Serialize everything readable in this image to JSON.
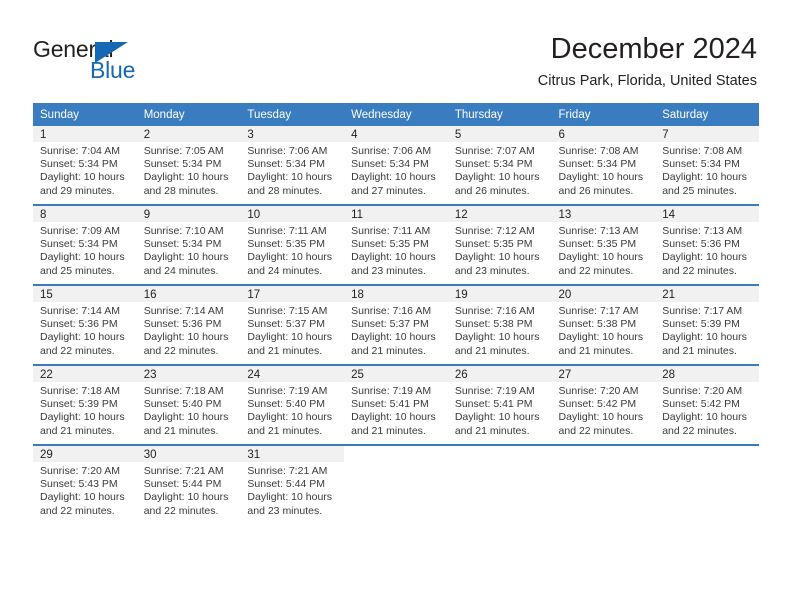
{
  "logo": {
    "text_primary": "General",
    "text_secondary": "Blue",
    "triangle_icon": "blue-triangle-icon",
    "primary_color": "#231f20",
    "secondary_color": "#1569b4"
  },
  "header": {
    "month_title": "December 2024",
    "location": "Citrus Park, Florida, United States"
  },
  "theme": {
    "header_bg": "#3a7cc0",
    "header_text": "#ffffff",
    "daynum_band_bg": "#f1f1f1",
    "cell_bg": "#ffffff",
    "body_text": "#3a3a3a",
    "separator": "#3a7cc0"
  },
  "weekdays": [
    "Sunday",
    "Monday",
    "Tuesday",
    "Wednesday",
    "Thursday",
    "Friday",
    "Saturday"
  ],
  "weeks": [
    [
      {
        "day": "1",
        "sunrise": "Sunrise: 7:04 AM",
        "sunset": "Sunset: 5:34 PM",
        "daylight": "Daylight: 10 hours and 29 minutes."
      },
      {
        "day": "2",
        "sunrise": "Sunrise: 7:05 AM",
        "sunset": "Sunset: 5:34 PM",
        "daylight": "Daylight: 10 hours and 28 minutes."
      },
      {
        "day": "3",
        "sunrise": "Sunrise: 7:06 AM",
        "sunset": "Sunset: 5:34 PM",
        "daylight": "Daylight: 10 hours and 28 minutes."
      },
      {
        "day": "4",
        "sunrise": "Sunrise: 7:06 AM",
        "sunset": "Sunset: 5:34 PM",
        "daylight": "Daylight: 10 hours and 27 minutes."
      },
      {
        "day": "5",
        "sunrise": "Sunrise: 7:07 AM",
        "sunset": "Sunset: 5:34 PM",
        "daylight": "Daylight: 10 hours and 26 minutes."
      },
      {
        "day": "6",
        "sunrise": "Sunrise: 7:08 AM",
        "sunset": "Sunset: 5:34 PM",
        "daylight": "Daylight: 10 hours and 26 minutes."
      },
      {
        "day": "7",
        "sunrise": "Sunrise: 7:08 AM",
        "sunset": "Sunset: 5:34 PM",
        "daylight": "Daylight: 10 hours and 25 minutes."
      }
    ],
    [
      {
        "day": "8",
        "sunrise": "Sunrise: 7:09 AM",
        "sunset": "Sunset: 5:34 PM",
        "daylight": "Daylight: 10 hours and 25 minutes."
      },
      {
        "day": "9",
        "sunrise": "Sunrise: 7:10 AM",
        "sunset": "Sunset: 5:34 PM",
        "daylight": "Daylight: 10 hours and 24 minutes."
      },
      {
        "day": "10",
        "sunrise": "Sunrise: 7:11 AM",
        "sunset": "Sunset: 5:35 PM",
        "daylight": "Daylight: 10 hours and 24 minutes."
      },
      {
        "day": "11",
        "sunrise": "Sunrise: 7:11 AM",
        "sunset": "Sunset: 5:35 PM",
        "daylight": "Daylight: 10 hours and 23 minutes."
      },
      {
        "day": "12",
        "sunrise": "Sunrise: 7:12 AM",
        "sunset": "Sunset: 5:35 PM",
        "daylight": "Daylight: 10 hours and 23 minutes."
      },
      {
        "day": "13",
        "sunrise": "Sunrise: 7:13 AM",
        "sunset": "Sunset: 5:35 PM",
        "daylight": "Daylight: 10 hours and 22 minutes."
      },
      {
        "day": "14",
        "sunrise": "Sunrise: 7:13 AM",
        "sunset": "Sunset: 5:36 PM",
        "daylight": "Daylight: 10 hours and 22 minutes."
      }
    ],
    [
      {
        "day": "15",
        "sunrise": "Sunrise: 7:14 AM",
        "sunset": "Sunset: 5:36 PM",
        "daylight": "Daylight: 10 hours and 22 minutes."
      },
      {
        "day": "16",
        "sunrise": "Sunrise: 7:14 AM",
        "sunset": "Sunset: 5:36 PM",
        "daylight": "Daylight: 10 hours and 22 minutes."
      },
      {
        "day": "17",
        "sunrise": "Sunrise: 7:15 AM",
        "sunset": "Sunset: 5:37 PM",
        "daylight": "Daylight: 10 hours and 21 minutes."
      },
      {
        "day": "18",
        "sunrise": "Sunrise: 7:16 AM",
        "sunset": "Sunset: 5:37 PM",
        "daylight": "Daylight: 10 hours and 21 minutes."
      },
      {
        "day": "19",
        "sunrise": "Sunrise: 7:16 AM",
        "sunset": "Sunset: 5:38 PM",
        "daylight": "Daylight: 10 hours and 21 minutes."
      },
      {
        "day": "20",
        "sunrise": "Sunrise: 7:17 AM",
        "sunset": "Sunset: 5:38 PM",
        "daylight": "Daylight: 10 hours and 21 minutes."
      },
      {
        "day": "21",
        "sunrise": "Sunrise: 7:17 AM",
        "sunset": "Sunset: 5:39 PM",
        "daylight": "Daylight: 10 hours and 21 minutes."
      }
    ],
    [
      {
        "day": "22",
        "sunrise": "Sunrise: 7:18 AM",
        "sunset": "Sunset: 5:39 PM",
        "daylight": "Daylight: 10 hours and 21 minutes."
      },
      {
        "day": "23",
        "sunrise": "Sunrise: 7:18 AM",
        "sunset": "Sunset: 5:40 PM",
        "daylight": "Daylight: 10 hours and 21 minutes."
      },
      {
        "day": "24",
        "sunrise": "Sunrise: 7:19 AM",
        "sunset": "Sunset: 5:40 PM",
        "daylight": "Daylight: 10 hours and 21 minutes."
      },
      {
        "day": "25",
        "sunrise": "Sunrise: 7:19 AM",
        "sunset": "Sunset: 5:41 PM",
        "daylight": "Daylight: 10 hours and 21 minutes."
      },
      {
        "day": "26",
        "sunrise": "Sunrise: 7:19 AM",
        "sunset": "Sunset: 5:41 PM",
        "daylight": "Daylight: 10 hours and 21 minutes."
      },
      {
        "day": "27",
        "sunrise": "Sunrise: 7:20 AM",
        "sunset": "Sunset: 5:42 PM",
        "daylight": "Daylight: 10 hours and 22 minutes."
      },
      {
        "day": "28",
        "sunrise": "Sunrise: 7:20 AM",
        "sunset": "Sunset: 5:42 PM",
        "daylight": "Daylight: 10 hours and 22 minutes."
      }
    ],
    [
      {
        "day": "29",
        "sunrise": "Sunrise: 7:20 AM",
        "sunset": "Sunset: 5:43 PM",
        "daylight": "Daylight: 10 hours and 22 minutes."
      },
      {
        "day": "30",
        "sunrise": "Sunrise: 7:21 AM",
        "sunset": "Sunset: 5:44 PM",
        "daylight": "Daylight: 10 hours and 22 minutes."
      },
      {
        "day": "31",
        "sunrise": "Sunrise: 7:21 AM",
        "sunset": "Sunset: 5:44 PM",
        "daylight": "Daylight: 10 hours and 23 minutes."
      },
      {
        "day": "",
        "sunrise": "",
        "sunset": "",
        "daylight": ""
      },
      {
        "day": "",
        "sunrise": "",
        "sunset": "",
        "daylight": ""
      },
      {
        "day": "",
        "sunrise": "",
        "sunset": "",
        "daylight": ""
      },
      {
        "day": "",
        "sunrise": "",
        "sunset": "",
        "daylight": ""
      }
    ]
  ]
}
